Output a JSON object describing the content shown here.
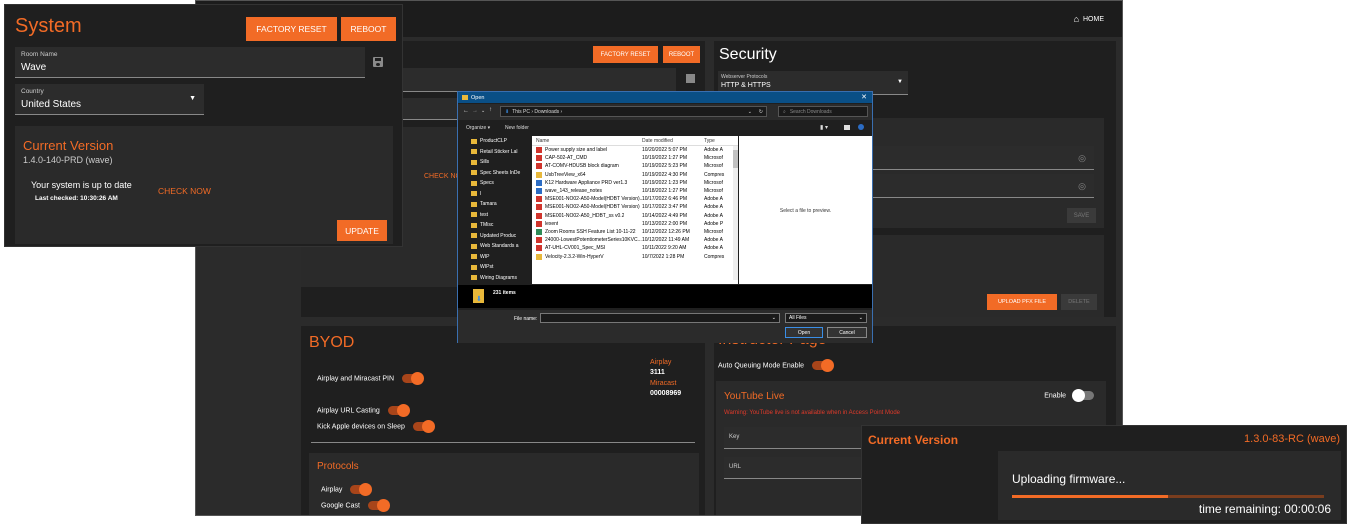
{
  "home_link": "HOME",
  "sys": {
    "title": "System",
    "factory_reset": "FACTORY RESET",
    "reboot": "REBOOT",
    "room_label": "Room Name",
    "room_value": "Wave",
    "country_label": "Country",
    "country_value": "United States",
    "cv_title": "Current Version",
    "cv_version": "1.4.0-140-PRD (wave)",
    "uptodate": "Your system is up to date",
    "last_checked": "Last checked: 10:30:26 AM",
    "check_now": "CHECK NOW",
    "update": "UPDATE"
  },
  "bg": {
    "factory_reset": "FACTORY RESET",
    "reboot": "REBOOT",
    "check_now": "CHECK NOW",
    "security_title": "Security",
    "webserver_label": "Webserver Protocols",
    "webserver_value": "HTTP & HTTPS",
    "save": "SAVE",
    "upload_pfx": "UPLOAD PFX FILE",
    "delete": "DELETE",
    "byod_title": "BYOD",
    "airplay_miracast_pin": "Airplay and Miracast PIN",
    "airplay_url_casting": "Airplay URL Casting",
    "kick_apple": "Kick Apple devices on Sleep",
    "airplay_label": "Airplay",
    "airplay_code": "3111",
    "miracast_label": "Miracast",
    "miracast_code": "00008969",
    "protocols_title": "Protocols",
    "protocol_airplay": "Airplay",
    "protocol_gcast": "Google Cast",
    "instructor_title": "Instructor Page",
    "auto_queue": "Auto Queuing Mode Enable",
    "youtube_title": "YouTube Live",
    "enable": "Enable",
    "youtube_warning": "Warning: YouTube live is not available when in Access Point Mode",
    "key_label": "Key",
    "url_label": "URL"
  },
  "dialog": {
    "title": "Open",
    "path": "This PC  ›  Downloads  ›",
    "search_placeholder": "Search Downloads",
    "organize": "Organize ▾",
    "new_folder": "New folder",
    "col_name": "Name",
    "col_date": "Date modified",
    "col_type": "Type",
    "preview_text": "Select a file to preview.",
    "item_count": "231 items",
    "filename_label": "File name:",
    "filter": "All Files",
    "open": "Open",
    "cancel": "Cancel",
    "tree": [
      "ProductCLP",
      "Retail Sticker Lal",
      "Sills",
      "Spec Sheets InDe",
      "Specs",
      "I",
      "Tamara",
      "test",
      "TMisc",
      "Updated Produc",
      "Web Standards a",
      "WIP",
      "WIPst",
      "Wiring Diagrams"
    ],
    "files": [
      {
        "name": "Power supply size and label",
        "date": "10/20/2022 5:07 PM",
        "type": "Adobe A",
        "icon": "#d0342c"
      },
      {
        "name": "CAP-502-AT_CMD",
        "date": "10/19/2022 1:27 PM",
        "type": "Microsof",
        "icon": "#d0342c"
      },
      {
        "name": "AT-COMV-HDUSB block diagram",
        "date": "10/19/2022 5:23 PM",
        "type": "Microsof",
        "icon": "#d0342c"
      },
      {
        "name": "UsbTreeView_x64",
        "date": "10/19/2022 4:30 PM",
        "type": "Compres",
        "icon": "#e8b83a"
      },
      {
        "name": "K12 Hardware Appliance PRD ver1.3",
        "date": "10/19/2022 1:23 PM",
        "type": "Microsof",
        "icon": "#2b6cc4"
      },
      {
        "name": "wave_143_release_notes",
        "date": "10/18/2022 1:27 PM",
        "type": "Microsof",
        "icon": "#2b6cc4"
      },
      {
        "name": "MSE001-NO02-A50-Model(HDBT Version)...",
        "date": "10/17/2022 6:46 PM",
        "type": "Adobe A",
        "icon": "#d0342c"
      },
      {
        "name": "MSE001-NO02-A50-Model(HDBT Version)",
        "date": "10/17/2022 3:47 PM",
        "type": "Adobe A",
        "icon": "#d0342c"
      },
      {
        "name": "MSE001-NO02-A50_HDBT_ss v0.2",
        "date": "10/14/2022 4:49 PM",
        "type": "Adobe A",
        "icon": "#d0342c"
      },
      {
        "name": "lexent",
        "date": "10/13/2022 2:00 PM",
        "type": "Adobe P",
        "icon": "#d0342c"
      },
      {
        "name": "Zoom Rooms SSH Feature List 10-11-22",
        "date": "10/12/2022 12:26 PM",
        "type": "Microsof",
        "icon": "#2e8b57"
      },
      {
        "name": "24000-LowestPotentiometerSeries10KVC...",
        "date": "10/12/2022 11:49 AM",
        "type": "Adobe A",
        "icon": "#d0342c"
      },
      {
        "name": "AT-UHL-CV001_Spec_MSI",
        "date": "10/11/2022 9:20 AM",
        "type": "Adobe A",
        "icon": "#d0342c"
      },
      {
        "name": "Velocity-2.3.2-Win-HyperV",
        "date": "10/7/2022 1:28 PM",
        "type": "Compres",
        "icon": "#e8b83a"
      }
    ]
  },
  "firmware": {
    "title": "Current Version",
    "version": "1.3.0-83-RC (wave)",
    "uploading": "Uploading firmware...",
    "progress": 0.5,
    "remaining": "time remaining: 00:00:06"
  }
}
